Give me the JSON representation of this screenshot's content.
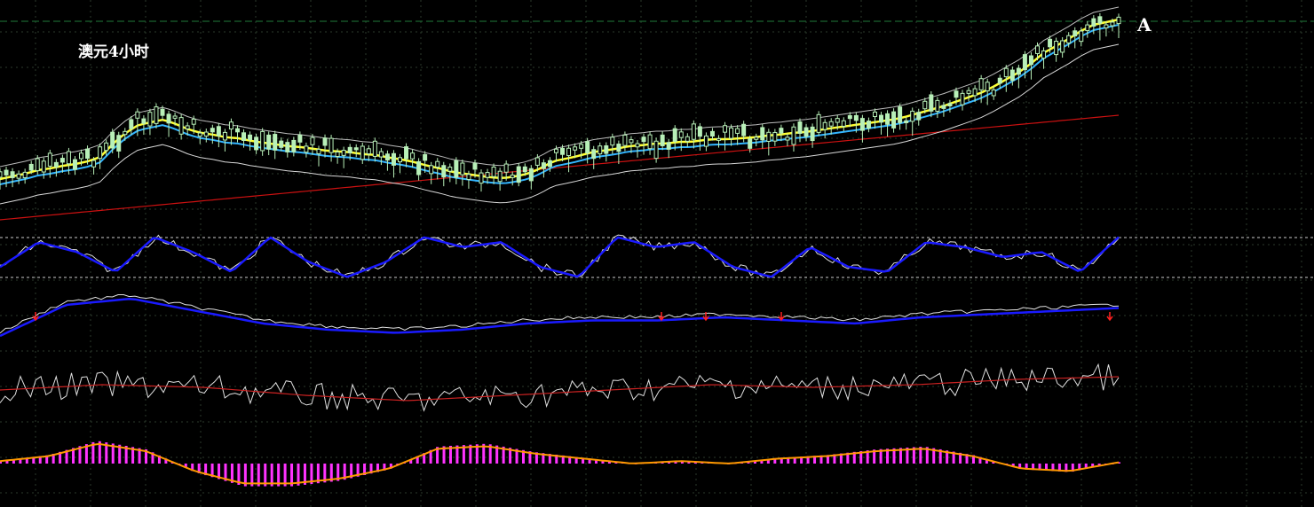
{
  "title": "澳元4小时",
  "marker_label": "A",
  "colors": {
    "background": "#000000",
    "grid": "#2b3a2b",
    "level_line": "#1f7a3a",
    "candle": "#b8f0b8",
    "ma_yellow": "#ffff33",
    "ma_cyan": "#33b5ff",
    "ma_white": "#d8d8d8",
    "ma_red": "#cc1111",
    "signal_blue": "#1a1aff",
    "signal_white": "#e0e0e0",
    "signal_red": "#cc2222",
    "histogram": "#ff33ff",
    "macd_line": "#ff9900",
    "arrow_red": "#ff2020",
    "arrow_green": "#22cc22"
  },
  "chart_data": [
    {
      "type": "candlestick",
      "title": "澳元4小时",
      "series": [
        {
          "name": "",
          "values": [
            202,
            199,
            196,
            192,
            190,
            187,
            185,
            182,
            177,
            162,
            150,
            141,
            138,
            135,
            140,
            146,
            150,
            152,
            155,
            156,
            159,
            161,
            163,
            165,
            166,
            168,
            170,
            171,
            172,
            174,
            175,
            178,
            180,
            183,
            187,
            190,
            194,
            196,
            198,
            200,
            201,
            199,
            196,
            190,
            182,
            179,
            176,
            172,
            170,
            168,
            165,
            164,
            162,
            162,
            160,
            160,
            158,
            157,
            157,
            156,
            155,
            153,
            152,
            150,
            149,
            147,
            145,
            143,
            141,
            139,
            137,
            135,
            132,
            128,
            124,
            120,
            115,
            110,
            105,
            98,
            90,
            82,
            72,
            60,
            52,
            44,
            35,
            28,
            25,
            22
          ]
        }
      ]
    },
    {
      "type": "line",
      "series": [
        {
          "name": "",
          "values": [
            0.3,
            0.8,
            0.6,
            0.2,
            0.9,
            0.6,
            0.2,
            0.9,
            0.4,
            0.1,
            0.4,
            0.9,
            0.7,
            0.8,
            0.3,
            0.1,
            0.9,
            0.7,
            0.8,
            0.3,
            0.1,
            0.7,
            0.3,
            0.2,
            0.8,
            0.7,
            0.5,
            0.6,
            0.2,
            0.9
          ]
        }
      ]
    },
    {
      "type": "line",
      "series": [
        {
          "name": "",
          "values": [
            0.3,
            0.8,
            0.9,
            0.7,
            0.5,
            0.4,
            0.35,
            0.4,
            0.5,
            0.55,
            0.55,
            0.6,
            0.55,
            0.5,
            0.6,
            0.65,
            0.7,
            0.75
          ]
        }
      ]
    },
    {
      "type": "line",
      "series": [
        {
          "name": "",
          "values": [
            0.5,
            0.6,
            0.55,
            0.4,
            0.3,
            0.4,
            0.5,
            0.6,
            0.55,
            0.6,
            0.7,
            0.75
          ]
        }
      ]
    },
    {
      "type": "bar",
      "series": [
        {
          "name": "",
          "values": [
            0.1,
            0.3,
            0.8,
            0.5,
            -0.3,
            -0.8,
            -0.8,
            -0.6,
            -0.2,
            0.6,
            0.7,
            0.4,
            0.2,
            0.0,
            0.1,
            0.0,
            0.2,
            0.3,
            0.5,
            0.6,
            0.3,
            -0.2,
            -0.3,
            0.05
          ]
        }
      ]
    }
  ]
}
